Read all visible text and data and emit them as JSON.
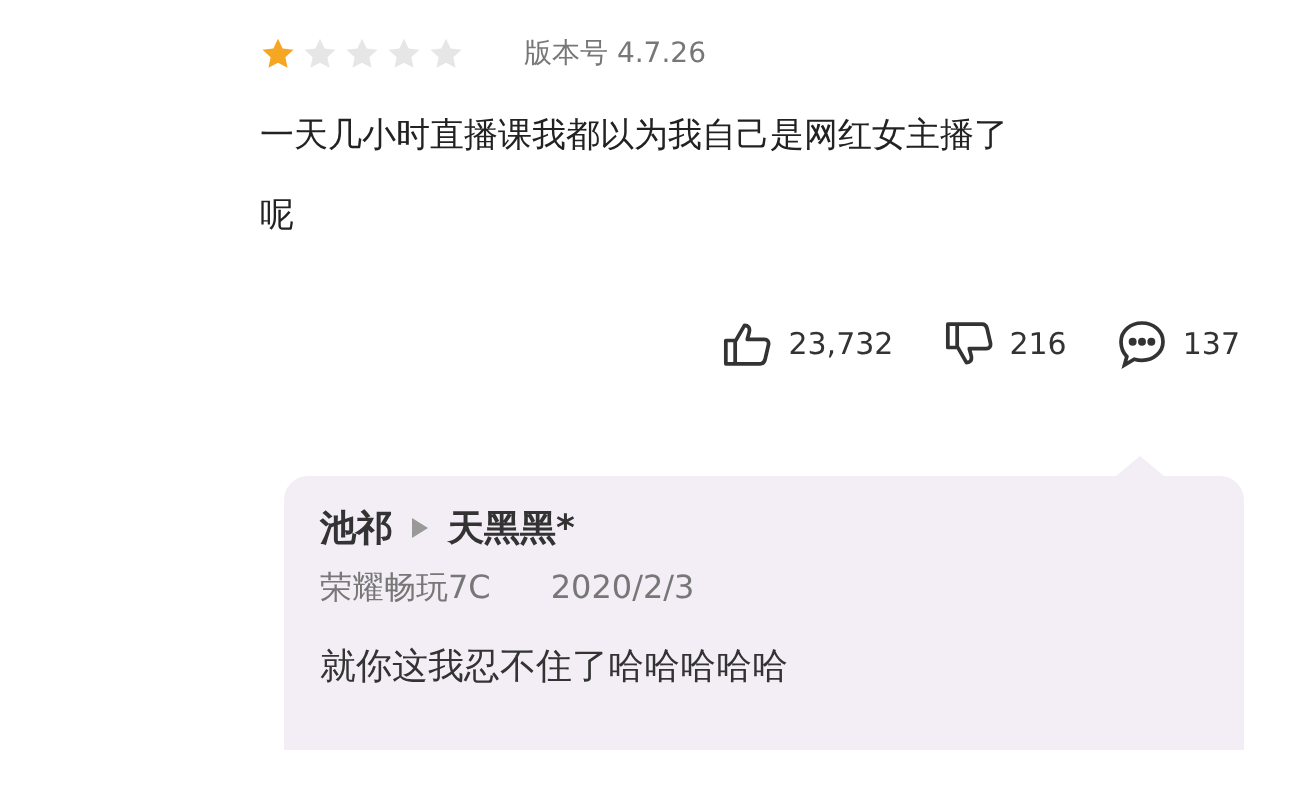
{
  "review": {
    "stars": 1,
    "version": "版本号 4.7.26",
    "text": "一天几小时直播课我都以为我自己是网红女主播了呢"
  },
  "actions": {
    "likes": "23,732",
    "dislikes": "216",
    "comments": "137"
  },
  "reply": {
    "author": "池祁",
    "target": "天黑黑*",
    "device": "荣耀畅玩7C",
    "date": "2020/2/3",
    "text": "就你这我忍不住了哈哈哈哈哈"
  }
}
